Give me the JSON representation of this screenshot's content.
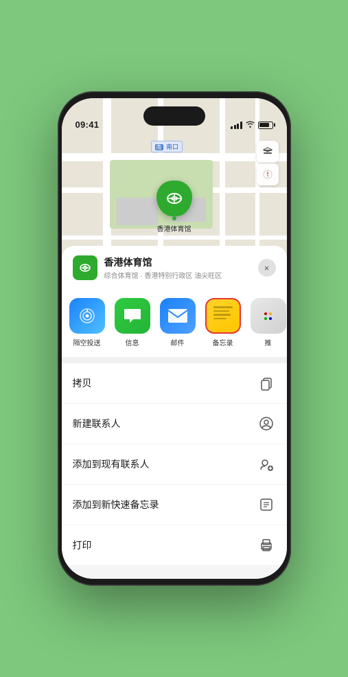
{
  "status_bar": {
    "time": "09:41",
    "location_arrow": "▶"
  },
  "map": {
    "south_gate_label": "南口",
    "south_gate_prefix": "南"
  },
  "map_controls": {
    "layers_label": "layers",
    "compass_label": "compass"
  },
  "stadium": {
    "pin_icon": "🏟",
    "name": "香港体育馆",
    "description": "综合体育馆 · 香港特别行政区 油尖旺区",
    "icon": "🏟"
  },
  "share_sheet": {
    "close_label": "×",
    "apps": [
      {
        "id": "airdrop",
        "label": "隔空投送",
        "icon": "airdrop"
      },
      {
        "id": "messages",
        "label": "信息",
        "icon": "messages"
      },
      {
        "id": "mail",
        "label": "邮件",
        "icon": "mail"
      },
      {
        "id": "notes",
        "label": "备忘录",
        "icon": "notes",
        "highlighted": true
      },
      {
        "id": "more",
        "label": "推",
        "icon": "more"
      }
    ],
    "actions": [
      {
        "id": "copy",
        "label": "拷贝",
        "icon": "copy"
      },
      {
        "id": "new-contact",
        "label": "新建联系人",
        "icon": "new-contact"
      },
      {
        "id": "add-contact",
        "label": "添加到现有联系人",
        "icon": "add-contact"
      },
      {
        "id": "add-note",
        "label": "添加到新快速备忘录",
        "icon": "add-note"
      },
      {
        "id": "print",
        "label": "打印",
        "icon": "print"
      }
    ]
  }
}
